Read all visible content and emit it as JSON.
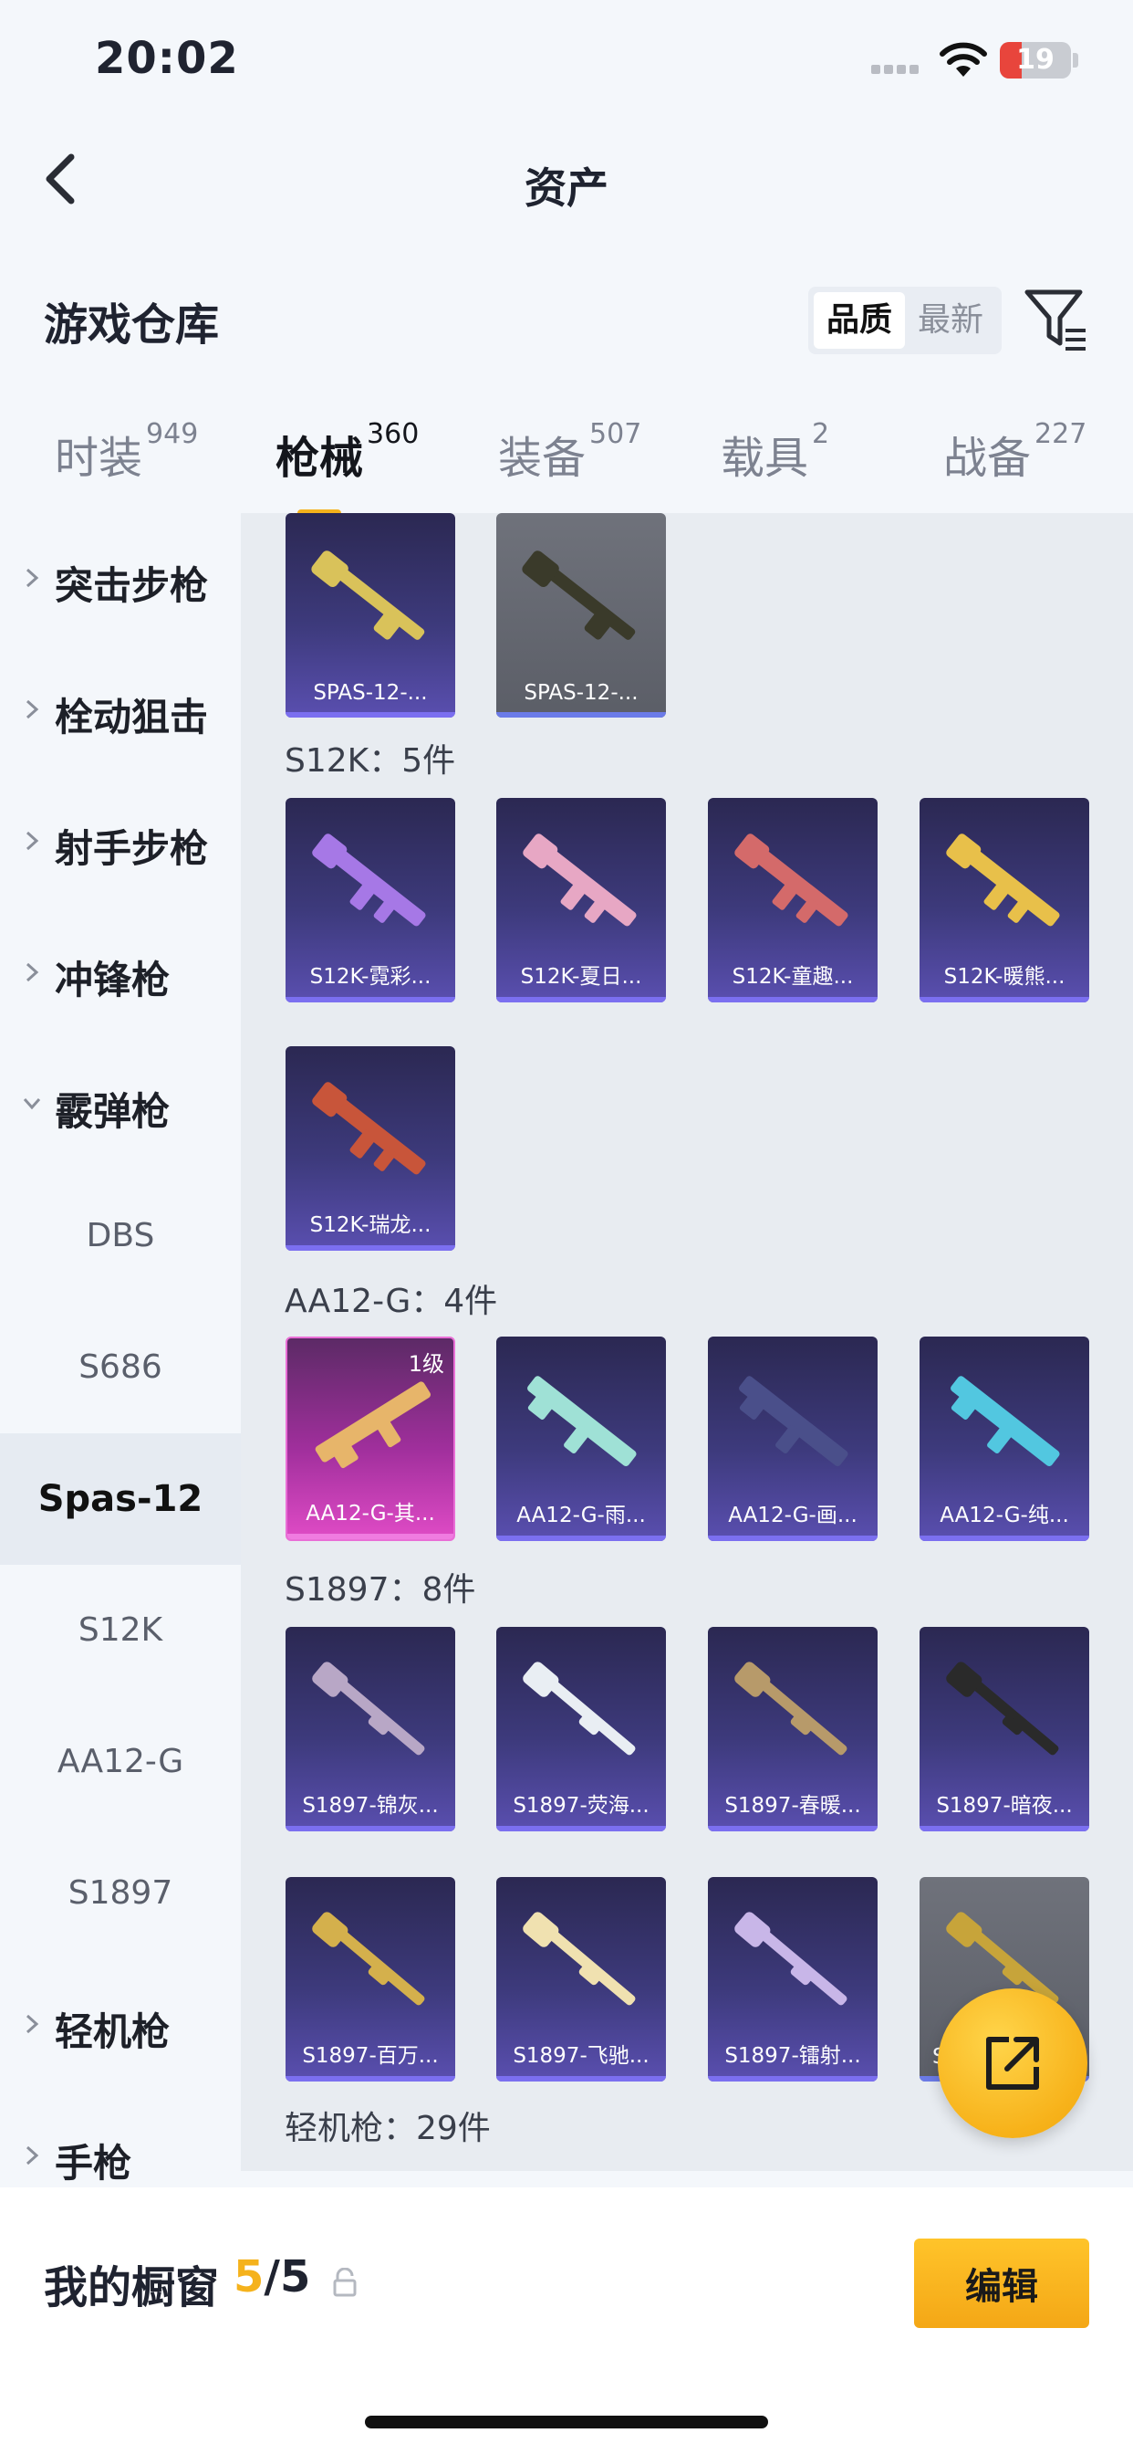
{
  "status_bar": {
    "time": "20:02",
    "battery": "19"
  },
  "nav": {
    "title": "资产",
    "back_icon": "chevron-left-icon"
  },
  "warehouse": {
    "label": "游戏仓库",
    "sort_options": [
      "品质",
      "最新"
    ],
    "selected_sort": "品质",
    "filter_icon": "filter-icon"
  },
  "tabs": [
    {
      "label": "时装",
      "count": "949"
    },
    {
      "label": "枪械",
      "count": "360",
      "active": true
    },
    {
      "label": "装备",
      "count": "507"
    },
    {
      "label": "载具",
      "count": "2"
    },
    {
      "label": "战备",
      "count": "227"
    }
  ],
  "sidebar": {
    "categories": [
      {
        "label": "突击步枪",
        "expanded": false
      },
      {
        "label": "栓动狙击",
        "expanded": false
      },
      {
        "label": "射手步枪",
        "expanded": false
      },
      {
        "label": "冲锋枪",
        "expanded": false
      },
      {
        "label": "霰弹枪",
        "expanded": true
      },
      {
        "label": "轻机枪",
        "expanded": false
      },
      {
        "label": "手枪",
        "expanded": false
      }
    ],
    "subitems": [
      "DBS",
      "S686",
      "Spas-12",
      "S12K",
      "AA12-G",
      "S1897"
    ],
    "active_subitem": "Spas-12"
  },
  "content": {
    "top_cards": [
      {
        "name": "SPAS-12-...",
        "style": "purple",
        "gun_color": "#d9c25a"
      },
      {
        "name": "SPAS-12-...",
        "style": "grey",
        "gun_color": "#3a3a2a"
      }
    ],
    "sections": [
      {
        "title": "S12K：5件",
        "cards": [
          {
            "name": "S12K-霓彩...",
            "gun_color": "#a678e6"
          },
          {
            "name": "S12K-夏日...",
            "gun_color": "#e7a7c4"
          },
          {
            "name": "S12K-童趣...",
            "gun_color": "#d46a6a"
          },
          {
            "name": "S12K-暖熊...",
            "gun_color": "#e8c04a"
          },
          {
            "name": "S12K-瑞龙...",
            "gun_color": "#c8553a"
          }
        ]
      },
      {
        "title": "AA12-G：4件",
        "cards": [
          {
            "name": "AA12-G-其...",
            "gun_color": "#e7b56a",
            "style": "pink",
            "level": "1级"
          },
          {
            "name": "AA12-G-雨...",
            "gun_color": "#9fe1d6"
          },
          {
            "name": "AA12-G-画...",
            "gun_color": "#4a4f8a"
          },
          {
            "name": "AA12-G-纯...",
            "gun_color": "#52c7e0"
          }
        ]
      },
      {
        "title": "S1897：8件",
        "cards": [
          {
            "name": "S1897-锦灰...",
            "gun_color": "#b8a7c6"
          },
          {
            "name": "S1897-荧海...",
            "gun_color": "#e9eef3"
          },
          {
            "name": "S1897-春暖...",
            "gun_color": "#b79a6a"
          },
          {
            "name": "S1897-暗夜...",
            "gun_color": "#2a2a2a"
          },
          {
            "name": "S1897-百万...",
            "gun_color": "#d4b04c"
          },
          {
            "name": "S1897-飞驰...",
            "gun_color": "#f0e1b0"
          },
          {
            "name": "S1897-镭射...",
            "gun_color": "#c8b6e8"
          },
          {
            "name": "S",
            "gun_color": "#c7a43a",
            "style": "grey"
          }
        ]
      },
      {
        "title": "轻机枪：29件",
        "cards": []
      }
    ]
  },
  "share_button": {
    "icon": "share-external-icon"
  },
  "bottom_bar": {
    "title": "我的橱窗",
    "current": "5",
    "total": "/5",
    "lock_icon": "lock-icon",
    "edit_label": "编辑"
  },
  "colors": {
    "accent": "#f5b21c",
    "card_purple": "#3d3a7c",
    "card_pink": "#a02f9c"
  }
}
